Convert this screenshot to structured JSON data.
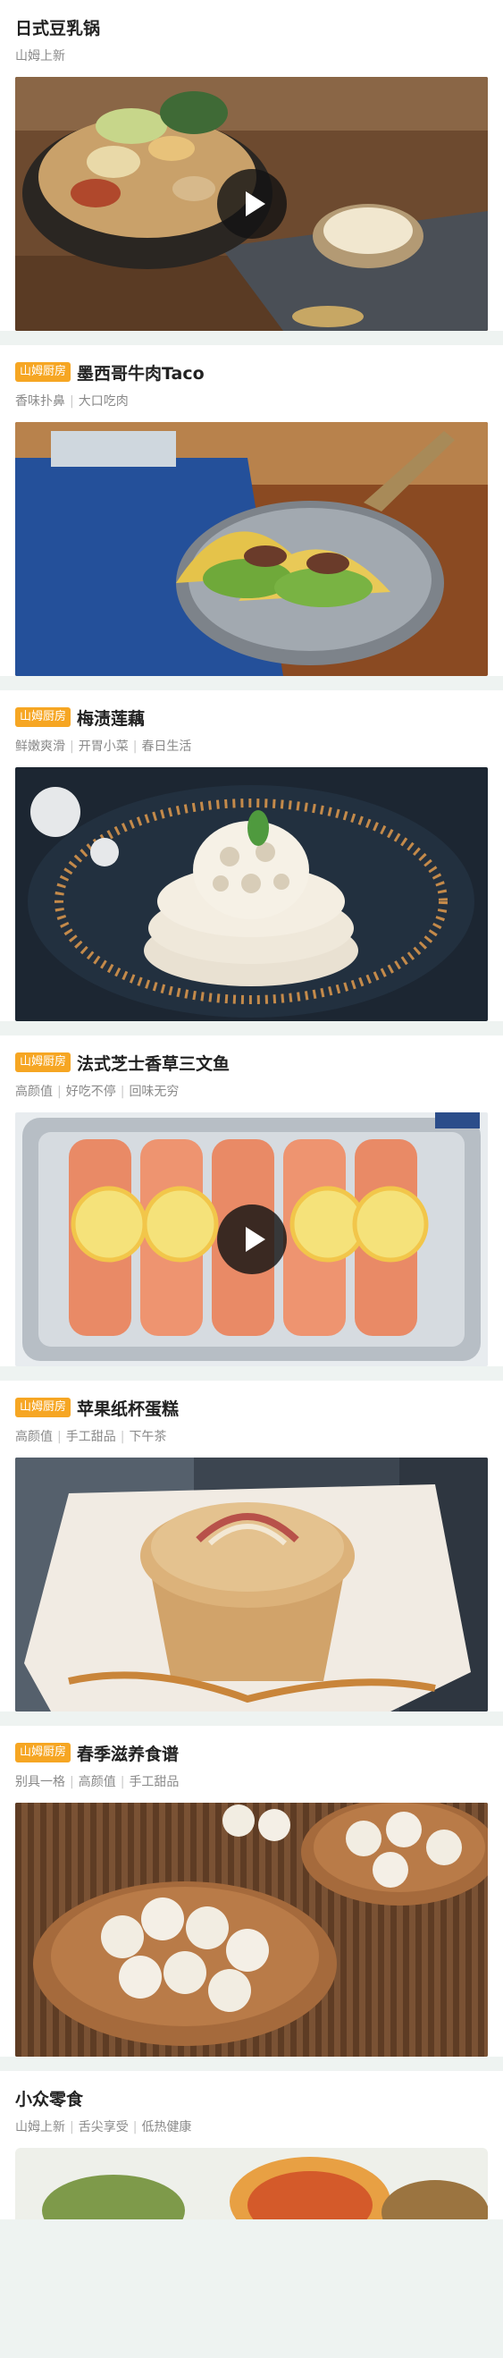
{
  "colors": {
    "badge": "#f6a623",
    "page_bg": "#eef3f1",
    "title": "#222222",
    "subtitle": "#8a8a8a"
  },
  "cards": [
    {
      "title": "日式豆乳锅",
      "badge": "",
      "tags": [
        "山姆上新"
      ],
      "has_video": true,
      "image": "soy-milk-hotpot-image"
    },
    {
      "title": "墨西哥牛肉Taco",
      "badge": "山姆厨房",
      "tags": [
        "香味扑鼻",
        "大口吃肉"
      ],
      "has_video": false,
      "image": "beef-taco-image"
    },
    {
      "title": "梅渍莲藕",
      "badge": "山姆厨房",
      "tags": [
        "鲜嫩爽滑",
        "开胃小菜",
        "春日生活"
      ],
      "has_video": false,
      "image": "plum-lotus-root-image"
    },
    {
      "title": "法式芝士香草三文鱼",
      "badge": "山姆厨房",
      "tags": [
        "高颜值",
        "好吃不停",
        "回味无穷"
      ],
      "has_video": true,
      "image": "cheese-herb-salmon-image"
    },
    {
      "title": "苹果纸杯蛋糕",
      "badge": "山姆厨房",
      "tags": [
        "高颜值",
        "手工甜品",
        "下午茶"
      ],
      "has_video": false,
      "image": "apple-cupcake-image"
    },
    {
      "title": "春季滋养食谱",
      "badge": "山姆厨房",
      "tags": [
        "别具一格",
        "高颜值",
        "手工甜品"
      ],
      "has_video": false,
      "image": "lotus-seed-recipe-image"
    },
    {
      "title": "小众零食",
      "badge": "",
      "tags": [
        "山姆上新",
        "舌尖享受",
        "低热健康"
      ],
      "has_video": false,
      "image": "snack-image"
    }
  ]
}
